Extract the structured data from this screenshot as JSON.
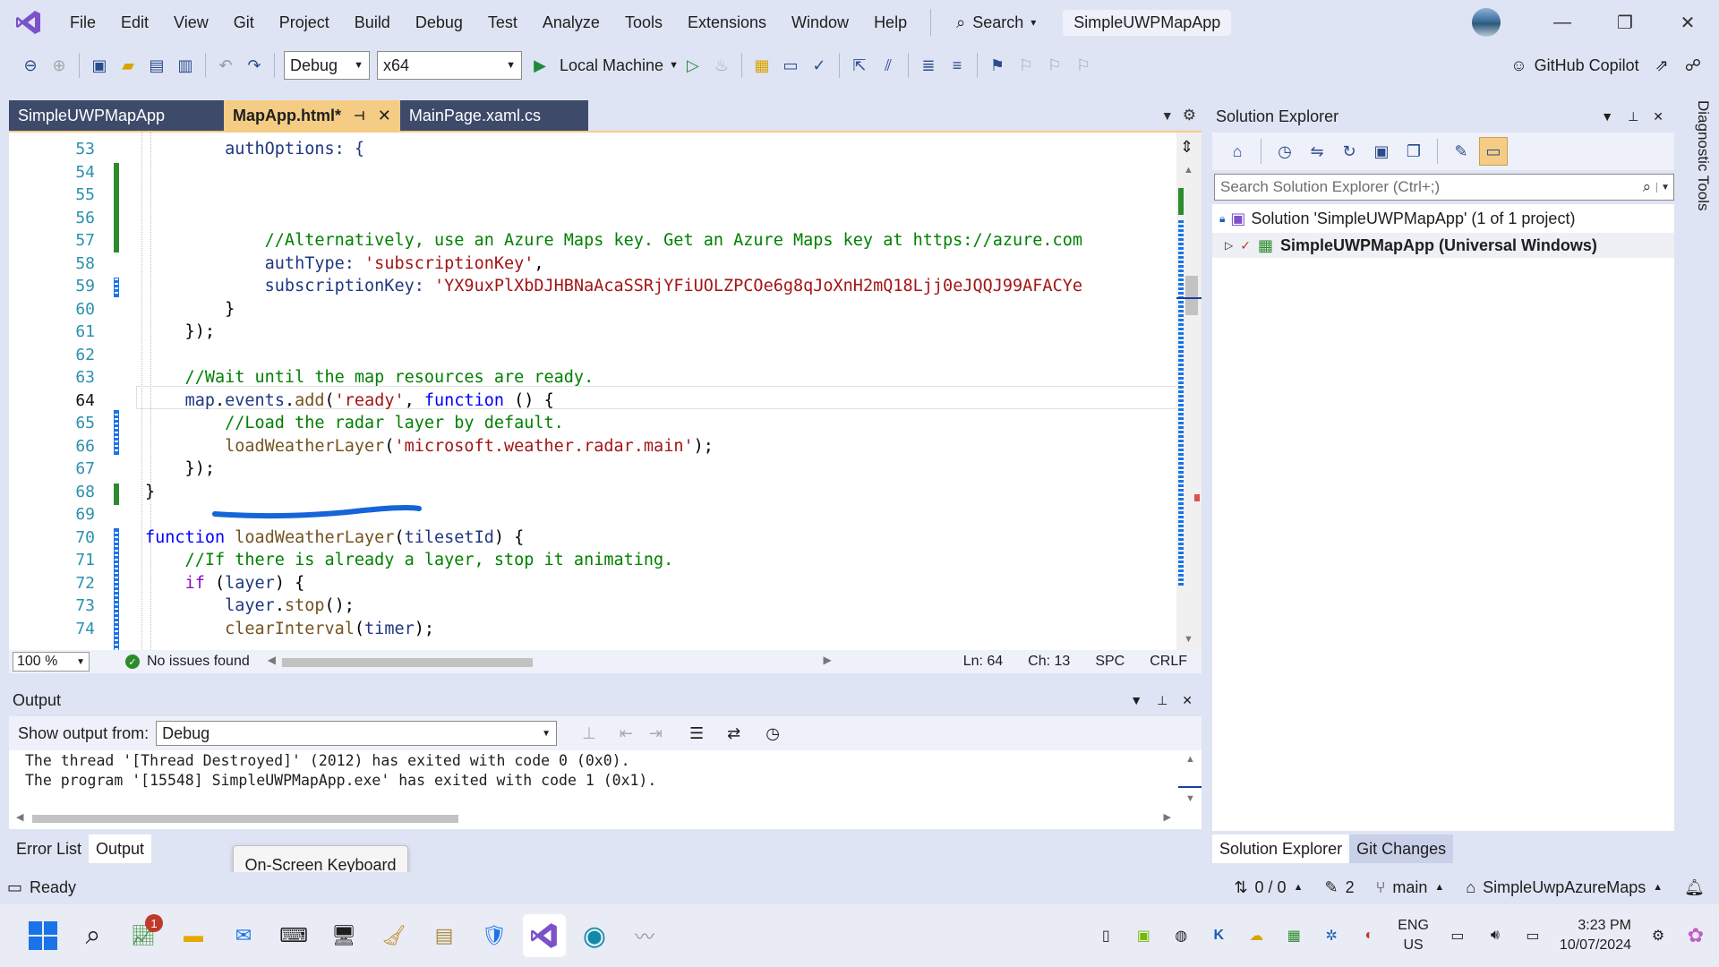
{
  "menu": {
    "items": [
      "File",
      "Edit",
      "View",
      "Git",
      "Project",
      "Build",
      "Debug",
      "Test",
      "Analyze",
      "Tools",
      "Extensions",
      "Window",
      "Help"
    ],
    "search_label": "Search",
    "solution_name": "SimpleUWPMapApp"
  },
  "toolbar": {
    "config": "Debug",
    "platform": "x64",
    "run_target": "Local Machine",
    "copilot": "GitHub Copilot"
  },
  "tabs": [
    {
      "label": "SimpleUWPMapApp"
    },
    {
      "label": "MapApp.html*"
    },
    {
      "label": "MainPage.xaml.cs"
    }
  ],
  "editor": {
    "lines": [
      {
        "n": "53",
        "t": "        authOptions: {"
      },
      {
        "n": "54",
        "t": ""
      },
      {
        "n": "55",
        "t": ""
      },
      {
        "n": "56",
        "t": ""
      },
      {
        "n": "57",
        "t": "            //Alternatively, use an Azure Maps key. Get an Azure Maps key at https://azure.com"
      },
      {
        "n": "58",
        "t": "            authType: 'subscriptionKey',"
      },
      {
        "n": "59",
        "t": "            subscriptionKey: 'YX9uxPlXbDJHBNaAcaSSRjYFiUOLZPCOe6g8qJoXnH2mQ18Ljj0eJQQJ99AFACYe"
      },
      {
        "n": "60",
        "t": "        }"
      },
      {
        "n": "61",
        "t": "    });"
      },
      {
        "n": "62",
        "t": ""
      },
      {
        "n": "63",
        "t": "    //Wait until the map resources are ready."
      },
      {
        "n": "64",
        "t": "    map.events.add('ready', function () {"
      },
      {
        "n": "65",
        "t": "        //Load the radar layer by default."
      },
      {
        "n": "66",
        "t": "        loadWeatherLayer('microsoft.weather.radar.main');"
      },
      {
        "n": "67",
        "t": "    });"
      },
      {
        "n": "68",
        "t": "}"
      },
      {
        "n": "69",
        "t": ""
      },
      {
        "n": "70",
        "t": "function loadWeatherLayer(tilesetId) {"
      },
      {
        "n": "71",
        "t": "    //If there is already a layer, stop it animating."
      },
      {
        "n": "72",
        "t": "    if (layer) {"
      },
      {
        "n": "73",
        "t": "        layer.stop();"
      },
      {
        "n": "74",
        "t": "        clearInterval(timer);"
      }
    ],
    "current_line": "64",
    "zoom": "100 %",
    "issues": "No issues found",
    "ln": "Ln: 64",
    "ch": "Ch: 13",
    "spc": "SPC",
    "eol": "CRLF"
  },
  "output": {
    "title": "Output",
    "show_from_label": "Show output from:",
    "source": "Debug",
    "lines": [
      "The thread '[Thread Destroyed]' (2012) has exited with code 0 (0x0).",
      "The program '[15548] SimpleUWPMapApp.exe' has exited with code 1 (0x1)."
    ],
    "tabs": [
      "Error List",
      "Output"
    ]
  },
  "solution_explorer": {
    "title": "Solution Explorer",
    "search_placeholder": "Search Solution Explorer (Ctrl+;)",
    "solution_row": "Solution 'SimpleUWPMapApp' (1 of 1 project)",
    "project_row": "SimpleUWPMapApp (Universal Windows)",
    "tabs": [
      "Solution Explorer",
      "Git Changes"
    ]
  },
  "diagnostic_tools": "Diagnostic Tools",
  "tooltip": "On-Screen Keyboard",
  "statusbar": {
    "ready": "Ready",
    "sync": "0 / 0",
    "edits": "2",
    "branch": "main",
    "repo": "SimpleUwpAzureMaps"
  },
  "taskbar": {
    "badge": "1",
    "lang_1": "ENG",
    "lang_2": "US",
    "time": "3:23 PM",
    "date": "10/07/2024"
  },
  "colors": {
    "accent": "#f5cc84",
    "chrome": "#dfe4f4",
    "comment": "#008000",
    "keyword": "#0000ff",
    "string": "#a31515"
  }
}
